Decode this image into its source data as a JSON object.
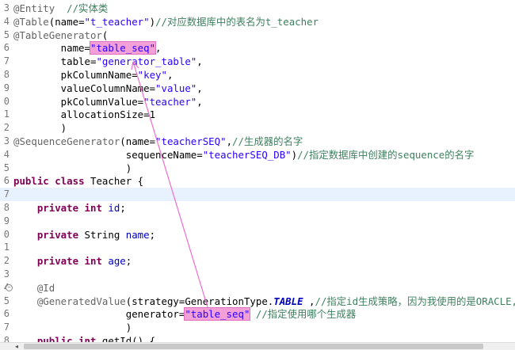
{
  "lines": [
    {
      "ln": "3",
      "parts": [
        [
          "ann",
          "@Entity"
        ],
        [
          "",
          "  "
        ],
        [
          "cmt",
          "//实体类"
        ]
      ]
    },
    {
      "ln": "4",
      "parts": [
        [
          "ann",
          "@Table"
        ],
        [
          "",
          "(name="
        ],
        [
          "str",
          "\"t_teacher\""
        ],
        [
          "",
          ")"
        ],
        [
          "cmt",
          "//对应数据库中的表名为t_teacher"
        ]
      ]
    },
    {
      "ln": "5",
      "parts": [
        [
          "ann",
          "@TableGenerator"
        ],
        [
          "",
          "("
        ]
      ]
    },
    {
      "ln": "6",
      "parts": [
        [
          "",
          "        name="
        ],
        [
          "str hl",
          "\"table_seq\""
        ],
        [
          "",
          ","
        ]
      ]
    },
    {
      "ln": "7",
      "parts": [
        [
          "",
          "        table="
        ],
        [
          "str",
          "\"generator_table\""
        ],
        [
          "",
          ","
        ]
      ]
    },
    {
      "ln": "8",
      "parts": [
        [
          "",
          "        pkColumnName="
        ],
        [
          "str",
          "\"key\""
        ],
        [
          "",
          ","
        ]
      ]
    },
    {
      "ln": "9",
      "parts": [
        [
          "",
          "        valueColumnName="
        ],
        [
          "str",
          "\"value\""
        ],
        [
          "",
          ","
        ]
      ]
    },
    {
      "ln": "0",
      "parts": [
        [
          "",
          "        pkColumnValue="
        ],
        [
          "str",
          "\"teacher\""
        ],
        [
          "",
          ","
        ]
      ]
    },
    {
      "ln": "1",
      "parts": [
        [
          "",
          "        allocationSize=1"
        ]
      ]
    },
    {
      "ln": "2",
      "parts": [
        [
          "",
          "        )"
        ]
      ]
    },
    {
      "ln": "3",
      "parts": [
        [
          "ann",
          "@SequenceGenerator"
        ],
        [
          "",
          "(name="
        ],
        [
          "str",
          "\"teacherSEQ\""
        ],
        [
          "",
          ","
        ],
        [
          "cmt",
          "//生成器的名字"
        ]
      ]
    },
    {
      "ln": "4",
      "parts": [
        [
          "",
          "                   sequenceName="
        ],
        [
          "str",
          "\"teacherSEQ_DB\""
        ],
        [
          "",
          ")"
        ],
        [
          "cmt",
          "//指定数据库中创建的sequence的名字"
        ]
      ]
    },
    {
      "ln": "5",
      "parts": [
        [
          "",
          "                   )"
        ]
      ]
    },
    {
      "ln": "6",
      "parts": [
        [
          "kw",
          "public"
        ],
        [
          "",
          " "
        ],
        [
          "kw",
          "class"
        ],
        [
          "",
          " Teacher {"
        ]
      ]
    },
    {
      "ln": "7",
      "parts": [
        [
          "",
          ""
        ]
      ],
      "current": true
    },
    {
      "ln": "8",
      "parts": [
        [
          "",
          "    "
        ],
        [
          "kw",
          "private"
        ],
        [
          "",
          " "
        ],
        [
          "kw",
          "int"
        ],
        [
          "",
          " "
        ],
        [
          "fld",
          "id"
        ],
        [
          "",
          ";"
        ]
      ]
    },
    {
      "ln": "9",
      "parts": [
        [
          "",
          ""
        ]
      ]
    },
    {
      "ln": "0",
      "parts": [
        [
          "",
          "    "
        ],
        [
          "kw",
          "private"
        ],
        [
          "",
          " String "
        ],
        [
          "fld",
          "name"
        ],
        [
          "",
          ";"
        ]
      ]
    },
    {
      "ln": "1",
      "parts": [
        [
          "",
          ""
        ]
      ]
    },
    {
      "ln": "2",
      "parts": [
        [
          "",
          "    "
        ],
        [
          "kw",
          "private"
        ],
        [
          "",
          " "
        ],
        [
          "kw",
          "int"
        ],
        [
          "",
          " "
        ],
        [
          "fld",
          "age"
        ],
        [
          "",
          ";"
        ]
      ]
    },
    {
      "ln": "3",
      "parts": [
        [
          "",
          ""
        ]
      ]
    },
    {
      "ln": "4",
      "parts": [
        [
          "",
          "    "
        ],
        [
          "ann",
          "@Id"
        ]
      ],
      "fold": "⊖"
    },
    {
      "ln": "5",
      "parts": [
        [
          "",
          "    "
        ],
        [
          "ann",
          "@GeneratedValue"
        ],
        [
          "",
          "(strategy=GenerationType."
        ],
        [
          "sfld",
          "TABLE"
        ],
        [
          "",
          " ,"
        ],
        [
          "cmt",
          "//指定id生成策略，因为我使用的是ORACLE,"
        ]
      ]
    },
    {
      "ln": "6",
      "parts": [
        [
          "",
          "                   generator="
        ],
        [
          "str hl",
          "\"table_seq\""
        ],
        [
          "",
          " "
        ],
        [
          "cmt",
          "//指定使用哪个生成器"
        ]
      ]
    },
    {
      "ln": "7",
      "parts": [
        [
          "",
          "                   )"
        ]
      ]
    },
    {
      "ln": "8",
      "parts": [
        [
          "",
          "    "
        ],
        [
          "kw",
          "public"
        ],
        [
          "",
          " "
        ],
        [
          "kw",
          "int"
        ],
        [
          "",
          " getId() {"
        ]
      ]
    }
  ],
  "scrollbar": {
    "left_arrow": "◂"
  }
}
